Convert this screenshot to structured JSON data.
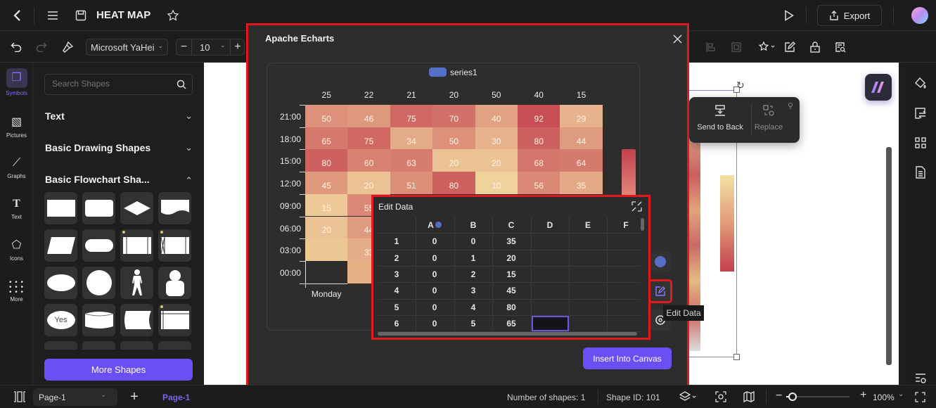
{
  "topbar": {
    "title": "HEAT MAP",
    "export_label": "Export",
    "icons": [
      "back-icon",
      "menu-icon",
      "save-icon",
      "star-icon",
      "play-icon",
      "export-icon",
      "avatar"
    ]
  },
  "toolbar": {
    "font_family": "Microsoft YaHei",
    "font_size": "10",
    "icons": [
      "undo-icon",
      "redo-icon",
      "format-painter-icon",
      "align-icon",
      "group-icon",
      "magic-icon",
      "edit-icon",
      "lock-icon",
      "search-doc-icon"
    ]
  },
  "leftrail": {
    "items": [
      {
        "label": "Symbols",
        "icon": "symbols-icon",
        "active": true
      },
      {
        "label": "Pictures",
        "icon": "pictures-icon"
      },
      {
        "label": "Graphs",
        "icon": "graphs-icon"
      },
      {
        "label": "Text",
        "icon": "text-icon"
      },
      {
        "label": "Icons",
        "icon": "icons-icon"
      },
      {
        "label": "More",
        "icon": "more-icon"
      }
    ]
  },
  "sidepanel": {
    "search_placeholder": "Search Shapes",
    "sections": [
      {
        "label": "Text",
        "expanded": false
      },
      {
        "label": "Basic Drawing Shapes",
        "expanded": false
      },
      {
        "label": "Basic Flowchart Sha...",
        "expanded": true
      }
    ],
    "shapes": [
      "rectangle",
      "rounded-rectangle",
      "diamond",
      "document",
      "parallelogram",
      "terminator",
      "predefined-process",
      "predefined-process-x",
      "ellipse",
      "circle",
      "actor",
      "person",
      "yes-ellipse",
      "cylinder",
      "stored-data",
      "internal-storage"
    ],
    "yes_label": "Yes",
    "more_shapes_label": "More Shapes"
  },
  "dialog": {
    "title": "Apache Echarts",
    "legend": "series1",
    "legend_color": "#5470c6",
    "insert_label": "Insert Into Canvas",
    "tooltip": "Edit Data"
  },
  "chart_data": {
    "type": "heatmap",
    "title": "",
    "legend": [
      "series1"
    ],
    "x_top_labels": [
      "25",
      "22",
      "21",
      "20",
      "50",
      "40",
      "15"
    ],
    "x_bottom_labels": [
      "Monday"
    ],
    "y_labels": [
      "21:00",
      "18:00",
      "15:00",
      "12:00",
      "09:00",
      "06:00",
      "03:00",
      "00:00"
    ],
    "rows": [
      [
        50,
        46,
        75,
        70,
        40,
        92,
        29
      ],
      [
        65,
        75,
        34,
        50,
        30,
        80,
        44
      ],
      [
        80,
        60,
        63,
        20,
        20,
        68,
        64
      ],
      [
        45,
        20,
        51,
        80,
        10,
        56,
        35
      ],
      [
        15,
        55,
        null,
        null,
        null,
        null,
        null
      ],
      [
        20,
        44,
        null,
        null,
        null,
        null,
        null
      ],
      [
        null,
        33,
        null,
        null,
        null,
        null,
        null
      ],
      [
        null,
        null,
        null,
        null,
        null,
        null,
        null
      ]
    ],
    "color_range": [
      "#f5e2a6",
      "#c3414e"
    ]
  },
  "editdata": {
    "title": "Edit Data",
    "columns": [
      "A",
      "B",
      "C",
      "D",
      "E",
      "F"
    ],
    "rows": [
      {
        "n": "1",
        "A": "0",
        "B": "0",
        "C": "35"
      },
      {
        "n": "2",
        "A": "0",
        "B": "1",
        "C": "20"
      },
      {
        "n": "3",
        "A": "0",
        "B": "2",
        "C": "15"
      },
      {
        "n": "4",
        "A": "0",
        "B": "3",
        "C": "45"
      },
      {
        "n": "5",
        "A": "0",
        "B": "4",
        "C": "80"
      },
      {
        "n": "6",
        "A": "0",
        "B": "5",
        "C": "65"
      }
    ]
  },
  "context_toolbar": {
    "send_to_back": "Send to Back",
    "replace": "Replace"
  },
  "bottombar": {
    "page_select": "Page-1",
    "active_page": "Page-1",
    "shape_count": "Number of shapes: 1",
    "shape_id": "Shape ID: 101",
    "zoom": "100%",
    "zoom_fraction": 0.1
  }
}
